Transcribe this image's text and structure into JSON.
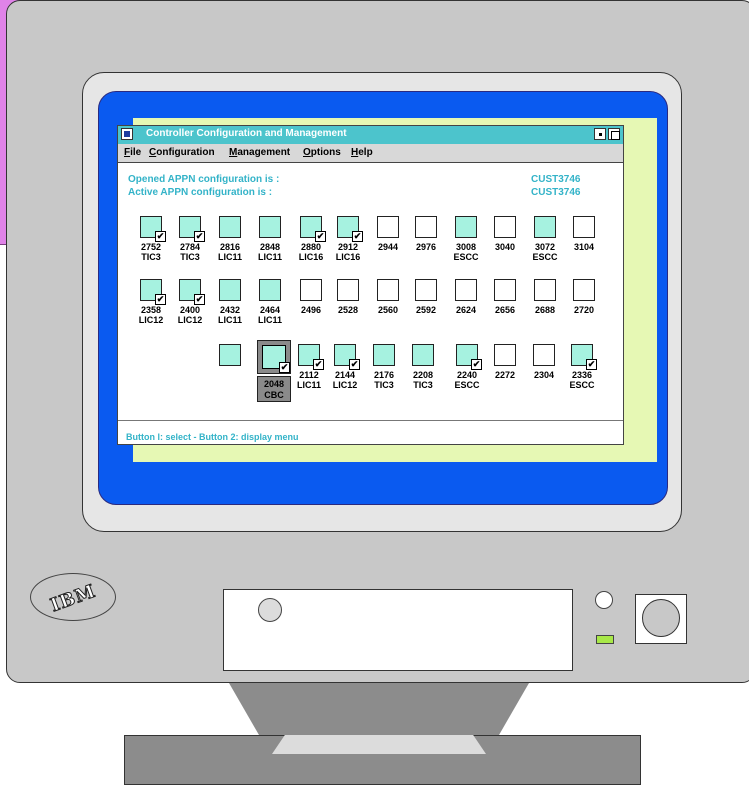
{
  "window": {
    "title": "Controller Configuration and Management"
  },
  "menu": [
    {
      "key": "F",
      "rest": "ile"
    },
    {
      "key": "C",
      "rest": "onfiguration"
    },
    {
      "key": "M",
      "rest": "anagement"
    },
    {
      "key": "O",
      "rest": "ptions"
    },
    {
      "key": "H",
      "rest": "elp"
    }
  ],
  "info": {
    "opened_label": "Opened APPN configuration is :",
    "active_label": "Active  APPN configuration is :",
    "opened_value": "CUST3746",
    "active_value": "CUST3746"
  },
  "rows": [
    [
      {
        "addr": "2752",
        "type": "TIC3",
        "filled": true,
        "checked": true
      },
      {
        "addr": "2784",
        "type": "TIC3",
        "filled": true,
        "checked": true
      },
      {
        "addr": "2816",
        "type": "LIC11",
        "filled": true,
        "checked": false
      },
      {
        "addr": "2848",
        "type": "LIC11",
        "filled": true,
        "checked": false
      },
      {
        "addr": "2880",
        "type": "LIC16",
        "filled": true,
        "checked": true
      },
      {
        "addr": "2912",
        "type": "LIC16",
        "filled": true,
        "checked": true
      },
      {
        "addr": "2944",
        "type": "",
        "filled": false,
        "checked": false
      },
      {
        "addr": "2976",
        "type": "",
        "filled": false,
        "checked": false
      },
      {
        "addr": "3008",
        "type": "ESCC",
        "filled": true,
        "checked": false
      },
      {
        "addr": "3040",
        "type": "",
        "filled": false,
        "checked": false
      },
      {
        "addr": "3072",
        "type": "ESCC",
        "filled": true,
        "checked": false
      },
      {
        "addr": "3104",
        "type": "",
        "filled": false,
        "checked": false
      }
    ],
    [
      {
        "addr": "2358",
        "type": "LIC12",
        "filled": true,
        "checked": true
      },
      {
        "addr": "2400",
        "type": "LIC12",
        "filled": true,
        "checked": true
      },
      {
        "addr": "2432",
        "type": "LIC11",
        "filled": true,
        "checked": false
      },
      {
        "addr": "2464",
        "type": "LIC11",
        "filled": true,
        "checked": false
      },
      {
        "addr": "2496",
        "type": "",
        "filled": false,
        "checked": false
      },
      {
        "addr": "2528",
        "type": "",
        "filled": false,
        "checked": false
      },
      {
        "addr": "2560",
        "type": "",
        "filled": false,
        "checked": false
      },
      {
        "addr": "2592",
        "type": "",
        "filled": false,
        "checked": false
      },
      {
        "addr": "2624",
        "type": "",
        "filled": false,
        "checked": false
      },
      {
        "addr": "2656",
        "type": "",
        "filled": false,
        "checked": false
      },
      {
        "addr": "2688",
        "type": "",
        "filled": false,
        "checked": false
      },
      {
        "addr": "2720",
        "type": "",
        "filled": false,
        "checked": false
      }
    ],
    [
      {
        "addr": "",
        "type": "",
        "filled": true,
        "checked": false
      },
      {
        "addr": "2048",
        "type": "CBC",
        "filled": true,
        "checked": true,
        "selected": true
      },
      {
        "addr": "2112",
        "type": "LIC11",
        "filled": true,
        "checked": true
      },
      {
        "addr": "2144",
        "type": "LIC12",
        "filled": true,
        "checked": true
      },
      {
        "addr": "2176",
        "type": "TIC3",
        "filled": true,
        "checked": false
      },
      {
        "addr": "2208",
        "type": "TIC3",
        "filled": true,
        "checked": false
      },
      {
        "addr": "2240",
        "type": "ESCC",
        "filled": true,
        "checked": true
      },
      {
        "addr": "2272",
        "type": "",
        "filled": false,
        "checked": false
      },
      {
        "addr": "2304",
        "type": "",
        "filled": false,
        "checked": false
      },
      {
        "addr": "2336",
        "type": "ESCC",
        "filled": true,
        "checked": true
      }
    ]
  ],
  "status": "Button l:  select   -   Button 2:  display menu",
  "logo_text": "IBM",
  "colors": {
    "accent": "#33b3c8",
    "titlebar": "#4cc4cc",
    "filled_box": "#a6f2e0",
    "screen_bezel": "#0a5af0"
  }
}
